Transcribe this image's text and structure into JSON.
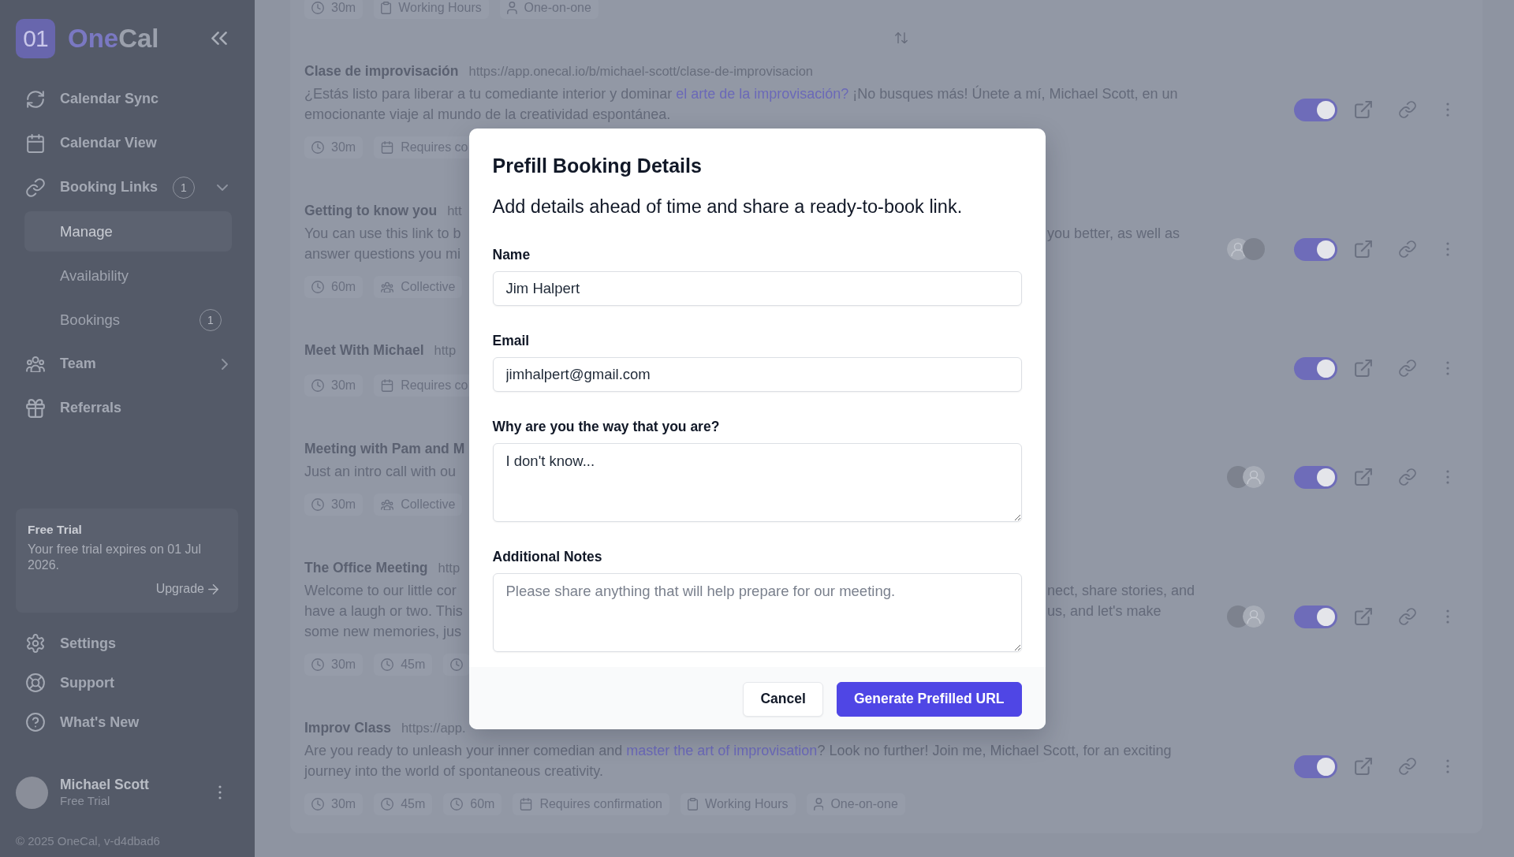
{
  "sidebar": {
    "logo": {
      "mark": "01",
      "name_parts": [
        {
          "text": "One",
          "accent": true
        },
        {
          "text": "Cal",
          "accent": false
        }
      ]
    },
    "nav": [
      {
        "label": "Calendar Sync",
        "selected": false
      },
      {
        "label": "Calendar View",
        "selected": false
      },
      {
        "label": "Booking Links",
        "badge": "1",
        "expanded": true,
        "selected": false,
        "children": [
          {
            "label": "Manage",
            "selected": true
          },
          {
            "label": "Availability",
            "selected": false
          },
          {
            "label": "Bookings",
            "badge": "1",
            "selected": false
          }
        ]
      },
      {
        "label": "Team",
        "expanded": false,
        "selected": false
      },
      {
        "label": "Referrals",
        "selected": false
      }
    ],
    "trial": {
      "title": "Free Trial",
      "text": "Your free trial expires on 01 Jul 2026.",
      "action": "Upgrade"
    },
    "bottom_nav": [
      {
        "label": "Settings",
        "selected": false
      },
      {
        "label": "Support",
        "selected": false
      },
      {
        "label": "What's New",
        "selected": false
      }
    ],
    "user": {
      "name": "Michael Scott",
      "plan": "Free Trial"
    },
    "footer": "© 2025 OneCal, v-d4dbad6"
  },
  "booking_links": {
    "top_row_meta": [
      {
        "kind": "duration",
        "text": "30m"
      },
      {
        "kind": "schedule",
        "text": "Working Hours"
      },
      {
        "kind": "single_host",
        "text": "One-on-one"
      }
    ],
    "rows": [
      {
        "title": "Clase de improvisación",
        "url": "https://app.onecal.io/b/michael-scott/clase-de-improvisacion",
        "description": [
          [
            {
              "kind": "text",
              "text": "¿Estás listo para liberar a tu comediante interior y dominar "
            },
            {
              "kind": "link",
              "text": "el arte de la improvisación?"
            },
            {
              "kind": "text",
              "text": " ¡No busques más! Únete a mí, Michael Scott, en un"
            }
          ],
          [
            {
              "kind": "text",
              "text": "emocionante viaje al mundo de la creatividad espontánea."
            }
          ]
        ],
        "meta": [
          {
            "kind": "duration",
            "text": "30m"
          },
          {
            "kind": "confirmation",
            "text": "Requires co"
          }
        ],
        "enabled": true
      },
      {
        "title": "Getting to know you",
        "url": "htt",
        "description_left": [
          "You can use this link to b",
          "answer questions you mi"
        ],
        "description_right": [
          "you better, as well as"
        ],
        "meta": [
          {
            "kind": "duration",
            "text": "60m"
          },
          {
            "kind": "group",
            "text": "Collective"
          }
        ],
        "avatars": [
          {
            "kind": "generic"
          },
          {
            "kind": "photo"
          }
        ],
        "enabled": true
      },
      {
        "title": "Meet With Michael",
        "url": "http",
        "meta": [
          {
            "kind": "duration",
            "text": "30m"
          },
          {
            "kind": "confirmation",
            "text": "Requires co"
          }
        ],
        "enabled": true
      },
      {
        "title": "Meeting with Pam and M",
        "description_left": [
          "Just an intro call with ou"
        ],
        "meta": [
          {
            "kind": "duration",
            "text": "30m"
          },
          {
            "kind": "group",
            "text": "Collective"
          }
        ],
        "avatars": [
          {
            "kind": "photo"
          },
          {
            "kind": "generic"
          }
        ],
        "enabled": true
      },
      {
        "title": "The Office Meeting",
        "url": "http",
        "description_left": [
          "Welcome to our little cor",
          "have a laugh or two. This",
          "some new memories, jus"
        ],
        "description_right": [
          "nect, share stories, and",
          "us, and let's make"
        ],
        "meta": [
          {
            "kind": "duration",
            "text": "30m"
          },
          {
            "kind": "duration",
            "text": "45m"
          },
          {
            "kind": "duration"
          }
        ],
        "avatars": [
          {
            "kind": "photo"
          },
          {
            "kind": "generic"
          }
        ],
        "enabled": true
      },
      {
        "title": "Improv Class",
        "url": "https://app.",
        "description": [
          [
            {
              "kind": "text",
              "text": "Are you ready to unleash your inner comedian and "
            },
            {
              "kind": "link",
              "text": "master the art of improvisation"
            },
            {
              "kind": "text",
              "text": "? Look no further! Join me, Michael Scott, for an exciting"
            }
          ],
          [
            {
              "kind": "text",
              "text": "journey into the world of spontaneous creativity."
            }
          ]
        ],
        "meta": [
          {
            "kind": "duration",
            "text": "30m"
          },
          {
            "kind": "duration",
            "text": "45m"
          },
          {
            "kind": "duration",
            "text": "60m"
          },
          {
            "kind": "confirmation",
            "text": "Requires confirmation"
          },
          {
            "kind": "schedule",
            "text": "Working Hours"
          },
          {
            "kind": "single_host",
            "text": "One-on-one"
          }
        ],
        "enabled": true
      }
    ]
  },
  "dialog": {
    "title": "Prefill Booking Details",
    "subtitle": "Add details ahead of time and share a ready-to-book link.",
    "fields": [
      {
        "label": "Name",
        "kind": "input",
        "value": "Jim Halpert"
      },
      {
        "label": "Email",
        "kind": "input",
        "value": "jimhalpert@gmail.com"
      },
      {
        "label": "Why are you the way that you are?",
        "kind": "textarea",
        "value": "I don't know..."
      },
      {
        "label": "Additional Notes",
        "kind": "textarea",
        "placeholder": "Please share anything that will help prepare for our meeting."
      }
    ],
    "buttons": [
      {
        "label": "Cancel",
        "kind": "secondary"
      },
      {
        "label": "Generate Prefilled URL",
        "kind": "primary"
      }
    ]
  }
}
